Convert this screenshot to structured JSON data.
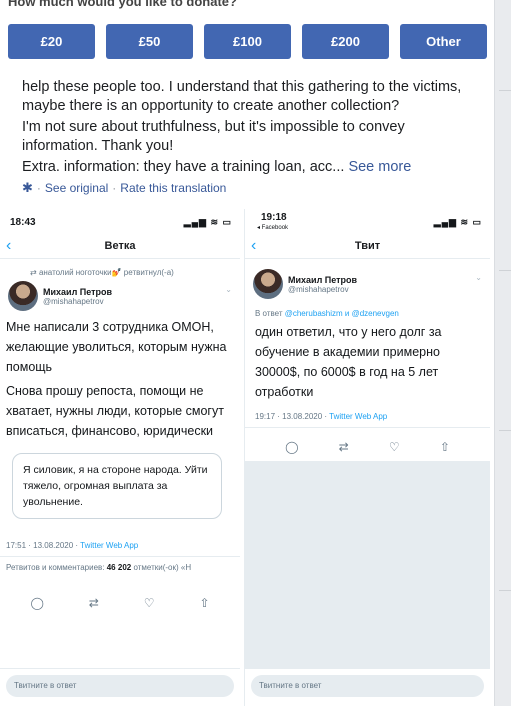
{
  "donate": {
    "question": "How much would you like to donate?",
    "options": [
      "£20",
      "£50",
      "£100",
      "£200",
      "Other"
    ]
  },
  "post": {
    "lines": [
      "help these people too. I understand that this gathering to the victims, maybe there is an opportunity to create another collection?",
      "I'm not sure about truthfulness, but it's impossible to convey information. Thank you!",
      "Extra. information: they have a training loan, acc..."
    ],
    "see_more": "See more",
    "see_original": "See original",
    "rate_translation": "Rate this translation",
    "separator": "·"
  },
  "phone1": {
    "time": "18:43",
    "status_icons": "▂▄▆ ≋ ▭",
    "title": "Ветка",
    "retweet_note": "анатолий ноготочки💅 ретвитнул(-а)",
    "user_name": "Михаил Петров",
    "user_handle": "@mishahapetrov",
    "text": [
      "Мне написали 3 сотрудника ОМОН, желающие уволиться, которым нужна помощь",
      "Снова прошу репоста, помощи не хватает, нужны люди, которые смогут вписаться, финансово, юридически"
    ],
    "quote": "Я силовик, я на стороне народа. Уйти тяжело, огромная выплата за увольнение.",
    "timestamp": "17:51 · 13.08.2020 · ",
    "source": "Twitter Web App",
    "stats_label": "Ретвитов и комментариев: ",
    "retweets": "46",
    "likes": "202",
    "likes_label": " отметки(-ок) «Н",
    "reply_placeholder": "Твитните в ответ"
  },
  "phone2": {
    "time": "19:18",
    "back_app": "◂ Facebook",
    "status_icons": "▂▄▆ ≋ ▭",
    "title": "Твит",
    "user_name": "Михаил Петров",
    "user_handle": "@mishahapetrov",
    "reply_to_prefix": "В ответ ",
    "reply_to": "@cherubashizm и @dzenevgen",
    "text": "один ответил, что у него долг за обучение в академии примерно 30000$, по 6000$ в год на 5 лет отработки",
    "timestamp": "19:17 · 13.08.2020 · ",
    "source": "Twitter Web App",
    "reply_placeholder": "Твитните в ответ"
  },
  "colors": {
    "button_blue": "#4267b2",
    "link_blue": "#385898",
    "twitter_blue": "#1da1f2"
  }
}
